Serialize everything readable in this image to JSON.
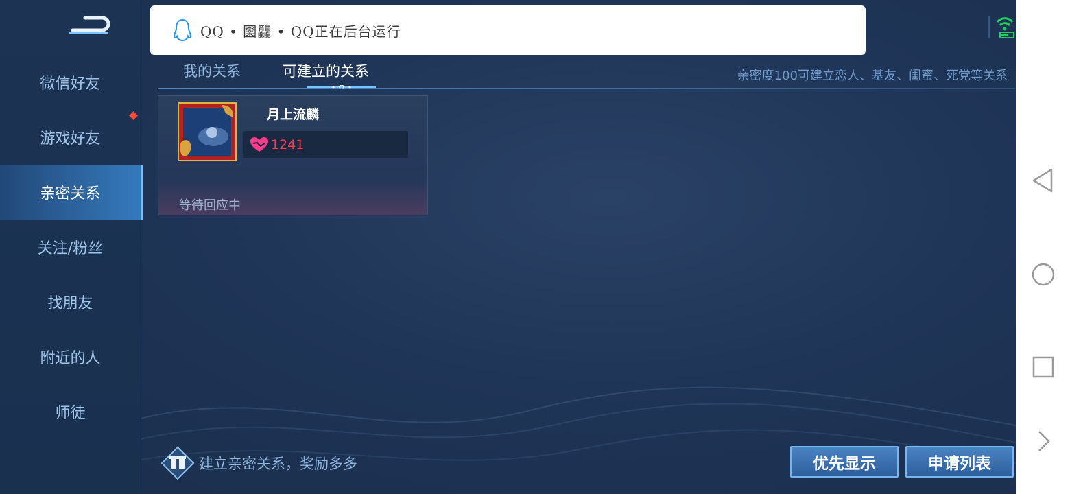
{
  "sidebar": {
    "items": [
      {
        "label": "微信好友"
      },
      {
        "label": "游戏好友",
        "has_dot": true
      },
      {
        "label": "亲密关系",
        "active": true
      },
      {
        "label": "关注/粉丝"
      },
      {
        "label": "找朋友"
      },
      {
        "label": "附近的人"
      },
      {
        "label": "师徒"
      }
    ]
  },
  "notification": {
    "text": "QQ • 圞龘 • QQ正在后台运行"
  },
  "tabs": [
    {
      "label": "我的关系",
      "active": false
    },
    {
      "label": "可建立的关系",
      "active": true
    }
  ],
  "hint": "亲密度100可建立恋人、基友、闺蜜、死党等关系",
  "card": {
    "name": "月上流麟",
    "intimacy": "1241",
    "status": "等待回应中"
  },
  "bottom": {
    "hint": "建立亲密关系，奖励多多",
    "priority_button": "优先显示",
    "apply_button": "申请列表"
  },
  "colors": {
    "background": "#1f3557",
    "accent": "#6bc3ff",
    "intimacy": "#ff3a55"
  }
}
